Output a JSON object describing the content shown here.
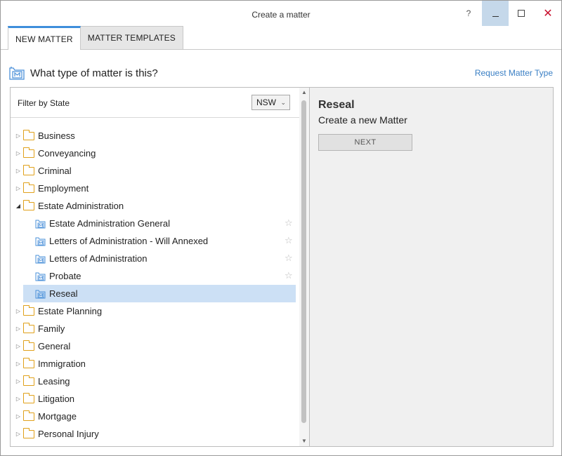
{
  "window": {
    "title": "Create a matter",
    "help": "?",
    "close": "✕"
  },
  "tabs": [
    {
      "label": "NEW MATTER",
      "active": true
    },
    {
      "label": "MATTER TEMPLATES",
      "active": false
    }
  ],
  "header": {
    "title": "What type of matter is this?",
    "request_link": "Request Matter Type"
  },
  "filter": {
    "label": "Filter by State",
    "selected": "NSW"
  },
  "tree": {
    "folders_before": [
      "Business",
      "Conveyancing",
      "Criminal",
      "Employment"
    ],
    "expanded_folder": "Estate Administration",
    "children": [
      {
        "label": "Estate Administration General",
        "selected": false
      },
      {
        "label": "Letters of Administration - Will Annexed",
        "selected": false
      },
      {
        "label": "Letters of Administration",
        "selected": false
      },
      {
        "label": "Probate",
        "selected": false
      },
      {
        "label": "Reseal",
        "selected": true
      }
    ],
    "folders_after": [
      "Estate Planning",
      "Family",
      "General",
      "Immigration",
      "Leasing",
      "Litigation",
      "Mortgage",
      "Personal Injury"
    ]
  },
  "detail": {
    "title": "Reseal",
    "subtitle": "Create a new Matter",
    "next_label": "NEXT"
  },
  "colors": {
    "accent": "#3e8edb",
    "selection": "#cce0f5",
    "folder": "#e0a11b",
    "link": "#3a7fc4",
    "close": "#c8102e"
  }
}
